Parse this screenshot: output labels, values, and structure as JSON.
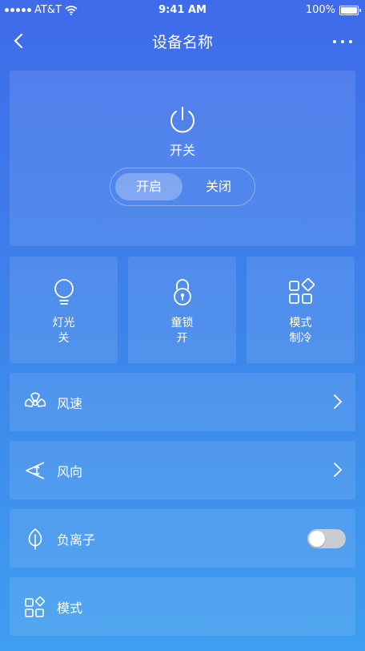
{
  "status_bar": {
    "carrier": "AT&T",
    "time": "9:41 AM",
    "battery": "100%"
  },
  "nav": {
    "title": "设备名称",
    "back_icon": "chevron-left-icon",
    "more_icon": "more-horizontal-icon"
  },
  "power": {
    "label": "开关",
    "icon": "power-icon",
    "on_label": "开启",
    "off_label": "关闭",
    "selected": "开启"
  },
  "tiles": [
    {
      "name": "灯光",
      "value": "关",
      "icon": "bulb-icon"
    },
    {
      "name": "童锁",
      "value": "开",
      "icon": "lock-icon"
    },
    {
      "name": "模式",
      "value": "制冷",
      "icon": "modes-icon"
    }
  ],
  "rows": [
    {
      "label": "风速",
      "icon": "fan-icon",
      "control": "chevron"
    },
    {
      "label": "风向",
      "icon": "wind-direction-icon",
      "control": "chevron"
    },
    {
      "label": "负离子",
      "icon": "leaf-icon",
      "control": "toggle",
      "toggle_on": false
    },
    {
      "label": "模式",
      "icon": "modes-icon",
      "control": "none"
    }
  ]
}
